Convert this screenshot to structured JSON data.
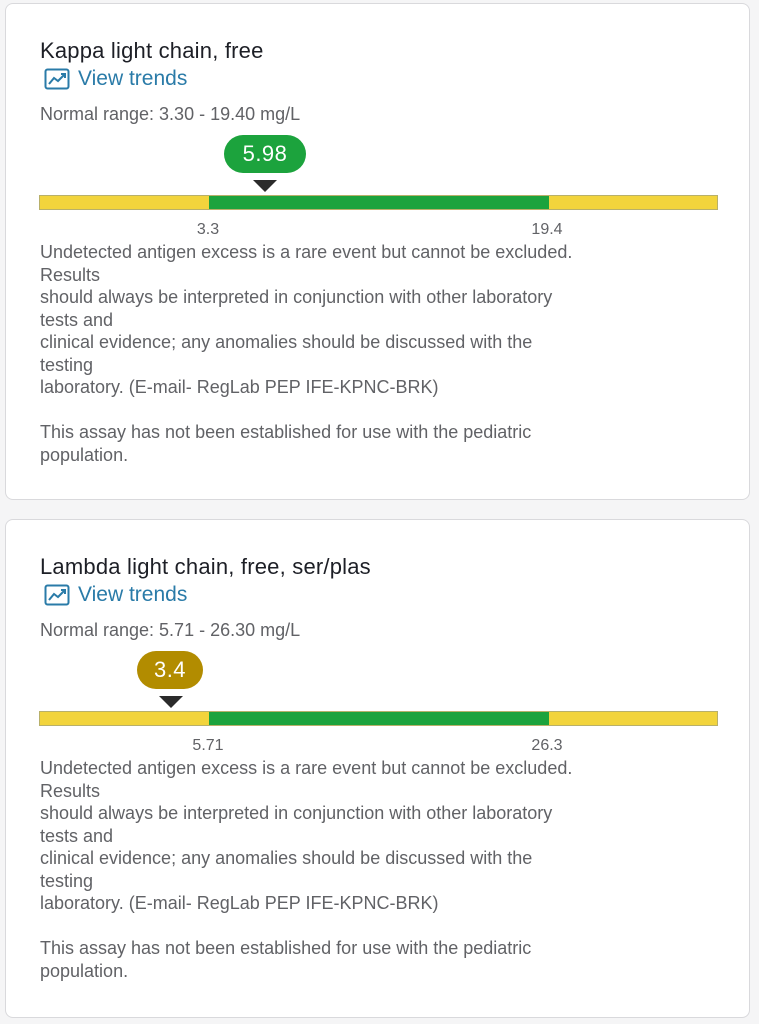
{
  "colors": {
    "normal_green": "#1ca33d",
    "out_of_range_yellow": "#f2d43c",
    "low_bubble": "#b28c00",
    "link_blue": "#2a7ba8"
  },
  "results": [
    {
      "title": "Kappa light chain, free",
      "trends_label": "View trends",
      "trends_icon": "line-chart-icon",
      "normal_range": "Normal range: 3.30 - 19.40 mg/L",
      "value": "5.98",
      "status": "normal",
      "range_low_label": "3.3",
      "range_high_label": "19.4",
      "comment_lines": [
        "Undetected antigen excess is a rare event but cannot be excluded.",
        "Results",
        "should always be interpreted in conjunction with other laboratory",
        "tests and",
        "clinical evidence; any anomalies should be discussed with the",
        "testing",
        "laboratory. (E-mail- RegLab PEP IFE-KPNC-BRK)",
        "",
        "This assay has not been established for use with the pediatric",
        "population."
      ]
    },
    {
      "title": "Lambda light chain, free, ser/plas",
      "trends_label": "View trends",
      "trends_icon": "line-chart-icon",
      "normal_range": "Normal range: 5.71 - 26.30 mg/L",
      "value": "3.4",
      "status": "low",
      "range_low_label": "5.71",
      "range_high_label": "26.3",
      "comment_lines": [
        "Undetected antigen excess is a rare event but cannot be excluded.",
        "Results",
        "should always be interpreted in conjunction with other laboratory",
        "tests and",
        "clinical evidence; any anomalies should be discussed with the",
        "testing",
        "laboratory. (E-mail- RegLab PEP IFE-KPNC-BRK)",
        "",
        "This assay has not been established for use with the pediatric",
        "population."
      ]
    }
  ]
}
